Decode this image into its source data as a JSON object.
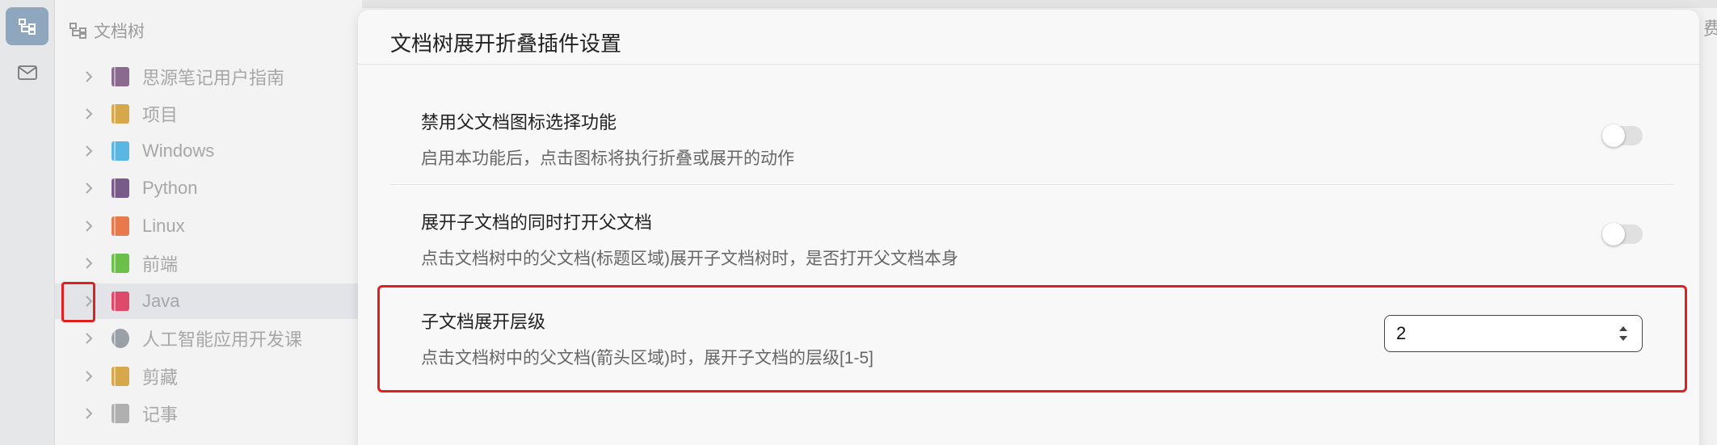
{
  "rail": {
    "items": [
      {
        "name": "doctree-icon",
        "active": true
      },
      {
        "name": "inbox-icon",
        "active": false
      }
    ]
  },
  "tree": {
    "header": "文档树",
    "items": [
      {
        "label": "思源笔记用户指南",
        "color": "#8a6a8e"
      },
      {
        "label": "项目",
        "color": "#d6a84a"
      },
      {
        "label": "Windows",
        "color": "#5ab6e2"
      },
      {
        "label": "Python",
        "color": "#7a5a8a"
      },
      {
        "label": "Linux",
        "color": "#e9784a"
      },
      {
        "label": "前端",
        "color": "#6cc04a"
      },
      {
        "label": "Java",
        "color": "#e04a6a"
      },
      {
        "label": "人工智能应用开发课",
        "color": "#9aa0a8"
      },
      {
        "label": "剪藏",
        "color": "#d6a84a"
      },
      {
        "label": "记事",
        "color": "#b0b0b0"
      }
    ]
  },
  "dialog": {
    "title": "文档树展开折叠插件设置",
    "settings": [
      {
        "title": "禁用父文档图标选择功能",
        "desc": "启用本功能后，点击图标将执行折叠或展开的动作",
        "enabled": false
      },
      {
        "title": "展开子文档的同时打开父文档",
        "desc": "点击文档树中的父文档(标题区域)展开子文档树时，是否打开父文档本身",
        "enabled": false
      },
      {
        "title": "子文档展开层级",
        "desc": "点击文档树中的父文档(箭头区域)时，展开子文档的层级[1-5]",
        "value": "2"
      }
    ]
  },
  "corner_text": "费"
}
